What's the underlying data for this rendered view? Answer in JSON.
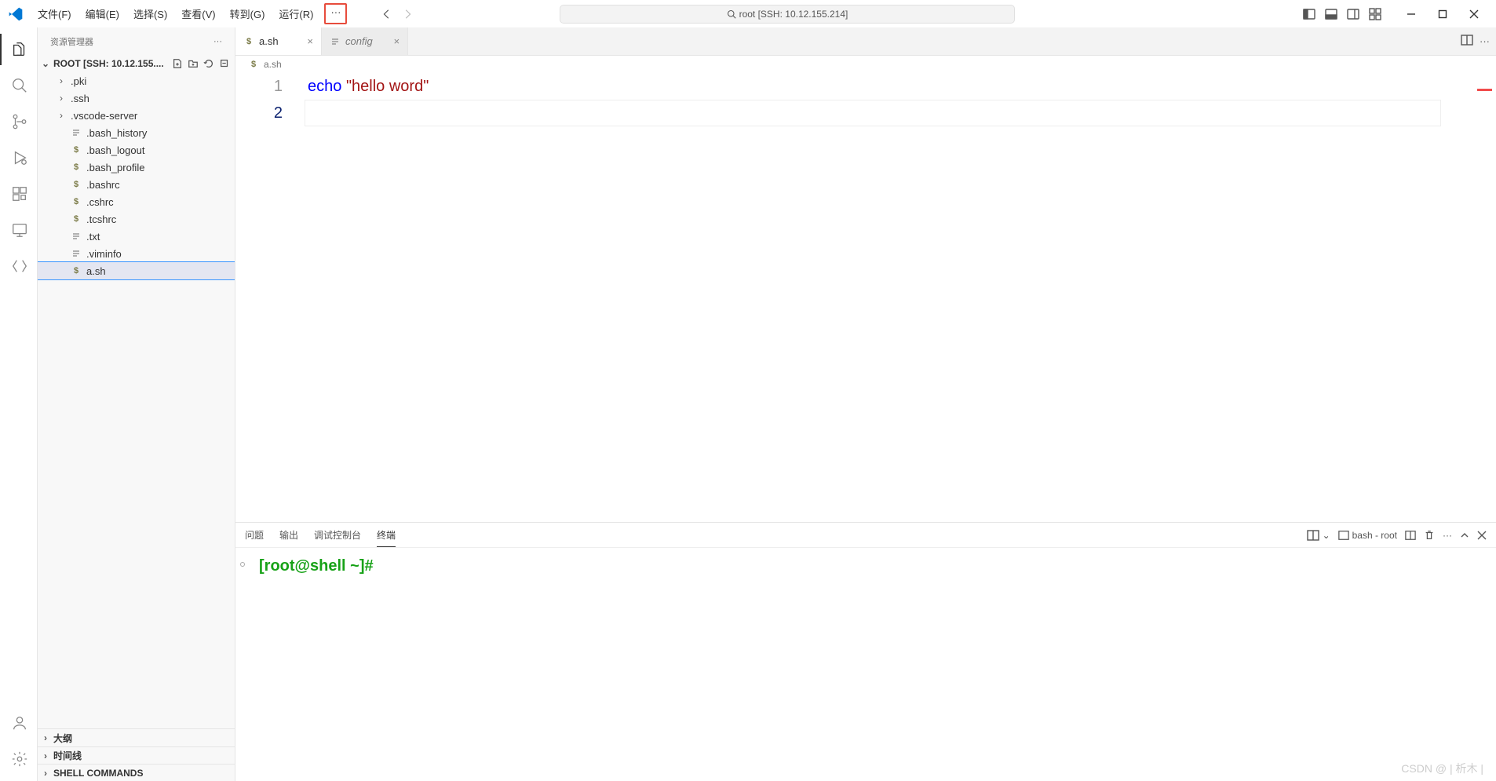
{
  "menu": {
    "file": "文件(F)",
    "edit": "编辑(E)",
    "select": "选择(S)",
    "view": "查看(V)",
    "go": "转到(G)",
    "run": "运行(R)",
    "more": "···"
  },
  "command_center": "root [SSH: 10.12.155.214]",
  "sidebar": {
    "title": "资源管理器",
    "root_label": "ROOT [SSH: 10.12.155....",
    "folders": [
      {
        "name": ".pki"
      },
      {
        "name": ".ssh"
      },
      {
        "name": ".vscode-server"
      }
    ],
    "files": [
      {
        "name": ".bash_history",
        "icon": "lines"
      },
      {
        "name": ".bash_logout",
        "icon": "dollar"
      },
      {
        "name": ".bash_profile",
        "icon": "dollar"
      },
      {
        "name": ".bashrc",
        "icon": "dollar"
      },
      {
        "name": ".cshrc",
        "icon": "dollar"
      },
      {
        "name": ".tcshrc",
        "icon": "dollar"
      },
      {
        "name": ".txt",
        "icon": "lines"
      },
      {
        "name": ".viminfo",
        "icon": "lines"
      },
      {
        "name": "a.sh",
        "icon": "dollar",
        "selected": true
      }
    ],
    "sections": {
      "outline": "大纲",
      "timeline": "时间线",
      "shell": "SHELL COMMANDS"
    }
  },
  "tabs": [
    {
      "label": "a.sh",
      "icon": "dollar",
      "active": true
    },
    {
      "label": "config",
      "icon": "lines",
      "italic": true
    }
  ],
  "breadcrumb": {
    "icon": "dollar",
    "file": "a.sh"
  },
  "code": {
    "line1": {
      "kw": "echo",
      "space": " ",
      "str": "\"hello word\""
    },
    "line_numbers": [
      "1",
      "2"
    ]
  },
  "panel": {
    "tabs": {
      "problems": "问题",
      "output": "输出",
      "debug": "调试控制台",
      "terminal": "终端"
    },
    "shell_label": "bash - root",
    "prompt": "[root@shell ~]#"
  },
  "watermark": "CSDN @ | 析木 |"
}
